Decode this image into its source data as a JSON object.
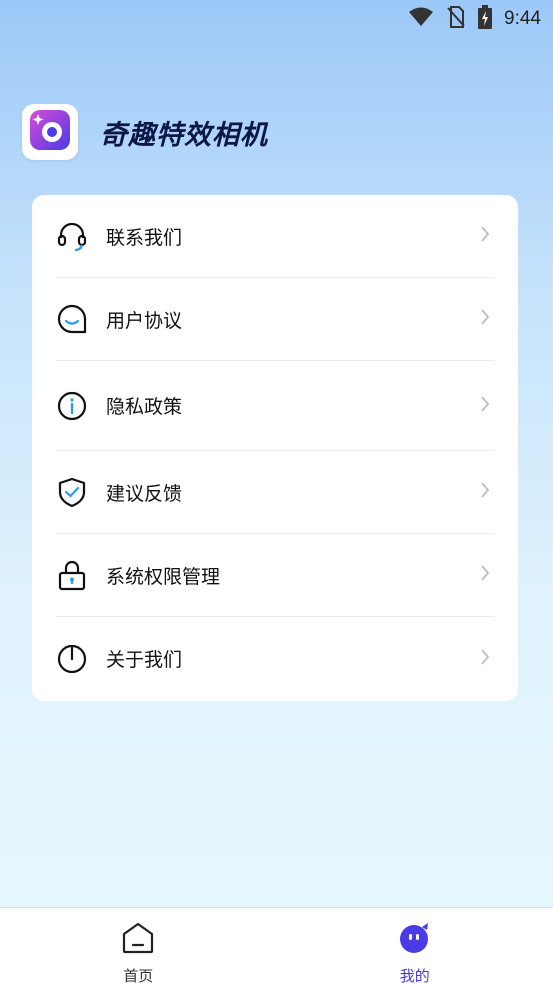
{
  "status_bar": {
    "time": "9:44",
    "icons": [
      "wifi-icon",
      "no-sim-icon",
      "battery-charging-icon"
    ]
  },
  "app": {
    "title": "奇趣特效相机",
    "logo_icon": "camera-lens-icon",
    "accent_color": "#4a3be6"
  },
  "menu": {
    "items": [
      {
        "label": "联系我们",
        "icon": "headset-icon"
      },
      {
        "label": "用户协议",
        "icon": "chat-bubble-icon"
      },
      {
        "label": "隐私政策",
        "icon": "info-icon"
      },
      {
        "label": "建议反馈",
        "icon": "shield-check-icon"
      },
      {
        "label": "系统权限管理",
        "icon": "lock-icon"
      },
      {
        "label": "关于我们",
        "icon": "power-icon"
      }
    ]
  },
  "tab_bar": {
    "tabs": [
      {
        "label": "首页",
        "icon": "home-icon",
        "active": false
      },
      {
        "label": "我的",
        "icon": "profile-face-icon",
        "active": true
      }
    ]
  }
}
